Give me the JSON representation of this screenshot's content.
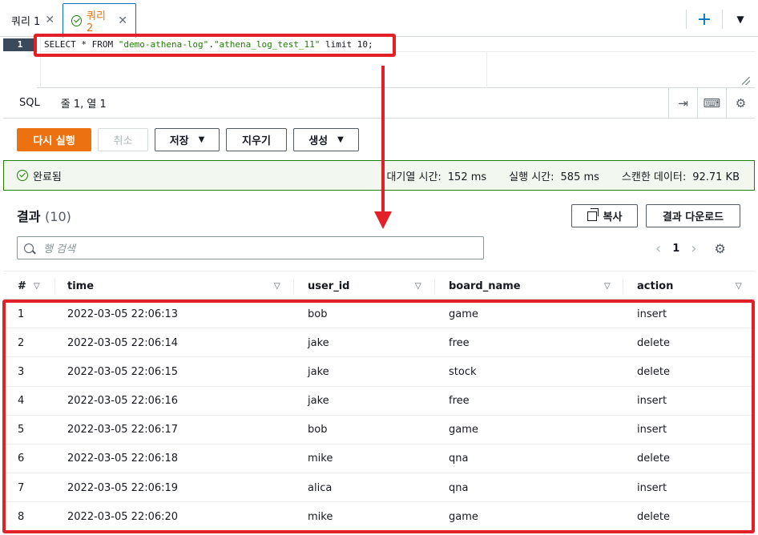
{
  "tabs": [
    {
      "label": "쿼리 1",
      "active": false
    },
    {
      "label": "쿼리 2",
      "active": true
    }
  ],
  "tab_actions": {
    "add_icon": "plus-icon",
    "menu_icon": "caret-down-icon"
  },
  "editor": {
    "line_number": "1",
    "query_prefix": "SELECT * FROM ",
    "query_db": "\"demo-athena-log\"",
    "query_dot": ".",
    "query_table": "\"athena_log_test_11\"",
    "query_suffix": " limit 10;"
  },
  "statusbar": {
    "language": "SQL",
    "position": "줄 1, 열 1"
  },
  "actions": {
    "rerun": "다시 실행",
    "cancel": "취소",
    "save": "저장",
    "clear": "지우기",
    "create": "생성"
  },
  "banner": {
    "status": "완료됨",
    "queue_label": "대기열 시간:",
    "queue_value": "152 ms",
    "run_label": "실행 시간:",
    "run_value": "585 ms",
    "scan_label": "스캔한 데이터:",
    "scan_value": "92.71 KB"
  },
  "results": {
    "title": "결과",
    "count": "(10)",
    "copy": "복사",
    "download": "결과 다운로드",
    "search_placeholder": "행 검색",
    "page": "1"
  },
  "colors": {
    "accent": "#ec7211",
    "success": "#1d8102",
    "highlight": "#e32027",
    "link": "#0073bb"
  },
  "table": {
    "columns": [
      "#",
      "time",
      "user_id",
      "board_name",
      "action"
    ],
    "rows": [
      [
        "1",
        "2022-03-05 22:06:13",
        "bob",
        "game",
        "insert"
      ],
      [
        "2",
        "2022-03-05 22:06:14",
        "jake",
        "free",
        "delete"
      ],
      [
        "3",
        "2022-03-05 22:06:15",
        "jake",
        "stock",
        "delete"
      ],
      [
        "4",
        "2022-03-05 22:06:16",
        "jake",
        "free",
        "insert"
      ],
      [
        "5",
        "2022-03-05 22:06:17",
        "bob",
        "game",
        "insert"
      ],
      [
        "6",
        "2022-03-05 22:06:18",
        "mike",
        "qna",
        "delete"
      ],
      [
        "7",
        "2022-03-05 22:06:19",
        "alica",
        "qna",
        "insert"
      ],
      [
        "8",
        "2022-03-05 22:06:20",
        "mike",
        "game",
        "delete"
      ]
    ]
  }
}
